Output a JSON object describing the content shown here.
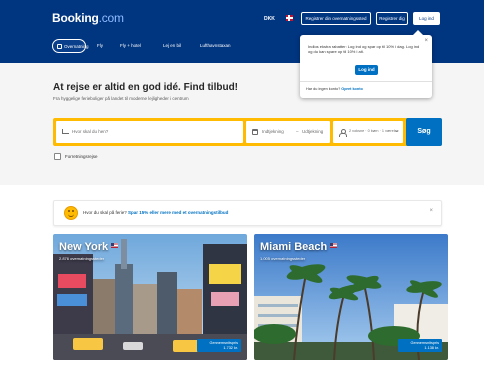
{
  "header": {
    "logo_main": "Booking",
    "logo_suffix": ".com",
    "currency": "DKK",
    "list_property_label": "Registrer din overnatningssted",
    "register_label": "Registrer dig",
    "login_label": "Log ind"
  },
  "nav": {
    "tabs": [
      {
        "label": "Overnatning",
        "active": true
      },
      {
        "label": "Fly"
      },
      {
        "label": "Fly + hotel"
      },
      {
        "label": "Lej en bil"
      },
      {
        "label": "Lufthavnstaxan"
      }
    ]
  },
  "popover": {
    "text": "Indlos ekstra rabatter: Log ind og spar op til 10% i dag. Log ind og du kan spare op til 10% i alt.",
    "button_label": "Log ind",
    "footer_text": "Har du ingen konto?",
    "footer_link": "Opret konto"
  },
  "hero": {
    "title": "At rejse er altid en god idé. Find tilbud!",
    "subtitle": "Fra hyggelige ferieboliger på landet til moderne lejligheder i centrum"
  },
  "search": {
    "destination_placeholder": "Hvor skal du hen?",
    "checkin_label": "Indtjekning",
    "checkout_label": "Udtjekning",
    "guests_label": "2 voksne · 0 børn · 1 værelse",
    "search_button": "Søg"
  },
  "work_trip": {
    "label": "Forretningsrejse"
  },
  "promo": {
    "text": "Hvor du skal på ferie?",
    "link": "Spar 15% eller mere med et overnatningstilbud"
  },
  "destinations": [
    {
      "name": "New York",
      "subtitle": "2.876 overnatningssteder",
      "price_label": "Gennemsnitspris",
      "price": "1.732 kr."
    },
    {
      "name": "Miami Beach",
      "subtitle": "1.005 overnatningssteder",
      "price_label": "Gennemsnitspris",
      "price": "1.138 kr."
    }
  ],
  "colors": {
    "brand_blue": "#003580",
    "action_blue": "#0071c2",
    "search_yellow": "#febb02"
  }
}
